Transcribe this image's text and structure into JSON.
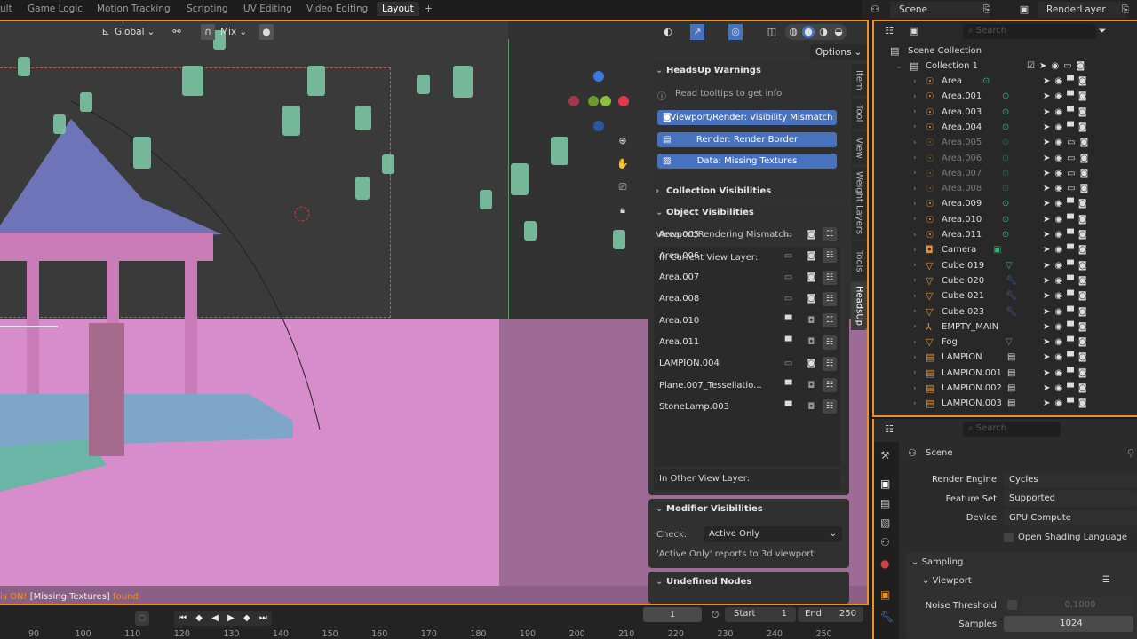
{
  "workspace_tabs": [
    "ult",
    "Game Logic",
    "Motion Tracking",
    "Scripting",
    "UV Editing",
    "Video Editing",
    "Layout"
  ],
  "active_workspace": "Layout",
  "add_workspace": "+",
  "scene_selector": {
    "scene": "Scene",
    "view_layer": "RenderLayer"
  },
  "viewport_header": {
    "orientation": "Global",
    "snap_mode": "Mix",
    "options": "Options"
  },
  "viewport_status": {
    "prefix": "is ON!",
    "tag": "[Missing Textures]",
    "suffix": "found"
  },
  "sidebar_tabs": [
    "Item",
    "Tool",
    "View",
    "Weight Layers",
    "Tools",
    "HeadsUp"
  ],
  "active_sidebar_tab": "HeadsUp",
  "headsup": {
    "warnings_title": "HeadsUp Warnings",
    "info": "Read tooltips to get info",
    "buttons": [
      {
        "label": "Viewport/Render: Visibility Mismatch",
        "icon": "camera-icon"
      },
      {
        "label": "Render: Render Border",
        "icon": "printer-icon"
      },
      {
        "label": "Data: Missing Textures",
        "icon": "image-icon"
      }
    ],
    "collection_visibilities": "Collection Visibilities",
    "object_visibilities": "Object Visibilities",
    "mismatch_label": "Viewport/Rendering Mismatch:",
    "current_layer_label": "In Current View Layer:",
    "objects": [
      {
        "name": "Area.005",
        "viewport": false,
        "render": true
      },
      {
        "name": "Area.006",
        "viewport": false,
        "render": true
      },
      {
        "name": "Area.007",
        "viewport": false,
        "render": true
      },
      {
        "name": "Area.008",
        "viewport": false,
        "render": true
      },
      {
        "name": "Area.010",
        "viewport": true,
        "render": false
      },
      {
        "name": "Area.011",
        "viewport": true,
        "render": false
      },
      {
        "name": "LAMPION.004",
        "viewport": false,
        "render": true
      },
      {
        "name": "Plane.007_Tessellatio...",
        "viewport": true,
        "render": false
      },
      {
        "name": "StoneLamp.003",
        "viewport": true,
        "render": false
      }
    ],
    "other_layer_label": "In Other View Layer:",
    "modifier_title": "Modifier Visibilities",
    "check_label": "Check:",
    "check_value": "Active Only",
    "check_note": "'Active Only' reports to 3d viewport",
    "undefined_nodes": "Undefined Nodes"
  },
  "outliner": {
    "search_placeholder": "Search",
    "scene_collection": "Scene Collection",
    "collection": "Collection 1",
    "items": [
      {
        "name": "Area",
        "icon": "light",
        "dim": false
      },
      {
        "name": "Area.001",
        "icon": "light",
        "dim": false
      },
      {
        "name": "Area.003",
        "icon": "light",
        "dim": false
      },
      {
        "name": "Area.004",
        "icon": "light",
        "dim": false
      },
      {
        "name": "Area.005",
        "icon": "light",
        "dim": true
      },
      {
        "name": "Area.006",
        "icon": "light",
        "dim": true
      },
      {
        "name": "Area.007",
        "icon": "light",
        "dim": true
      },
      {
        "name": "Area.008",
        "icon": "light",
        "dim": true
      },
      {
        "name": "Area.009",
        "icon": "light",
        "dim": false
      },
      {
        "name": "Area.010",
        "icon": "light",
        "dim": false
      },
      {
        "name": "Area.011",
        "icon": "light",
        "dim": false
      },
      {
        "name": "Camera",
        "icon": "camera",
        "dim": false
      },
      {
        "name": "Cube.019",
        "icon": "mesh",
        "dim": false
      },
      {
        "name": "Cube.020",
        "icon": "mesh",
        "dim": false
      },
      {
        "name": "Cube.021",
        "icon": "mesh",
        "dim": false
      },
      {
        "name": "Cube.023",
        "icon": "mesh",
        "dim": false
      },
      {
        "name": "EMPTY_MAIN",
        "icon": "empty",
        "dim": false
      },
      {
        "name": "Fog",
        "icon": "mesh",
        "dim": false
      },
      {
        "name": "LAMPION",
        "icon": "collection-instance",
        "dim": false
      },
      {
        "name": "LAMPION.001",
        "icon": "collection-instance",
        "dim": false
      },
      {
        "name": "LAMPION.002",
        "icon": "collection-instance",
        "dim": false
      },
      {
        "name": "LAMPION.003",
        "icon": "collection-instance",
        "dim": false
      }
    ]
  },
  "properties": {
    "search_placeholder": "Search",
    "context": "Scene",
    "render_engine_label": "Render Engine",
    "render_engine": "Cycles",
    "feature_set_label": "Feature Set",
    "feature_set": "Supported",
    "device_label": "Device",
    "device": "GPU Compute",
    "osl_label": "Open Shading Language",
    "sampling": "Sampling",
    "viewport": "Viewport",
    "noise_threshold_label": "Noise Threshold",
    "noise_threshold": "0.1000",
    "samples_label": "Samples",
    "samples": "1024"
  },
  "timeline": {
    "current_frame": "1",
    "start_label": "Start",
    "start": "1",
    "end_label": "End",
    "end": "250",
    "ticks": [
      "90",
      "100",
      "110",
      "120",
      "130",
      "140",
      "150",
      "160",
      "170",
      "180",
      "190",
      "200",
      "210",
      "220",
      "230",
      "240",
      "250"
    ]
  },
  "colors": {
    "accent": "#f0902a",
    "button_blue": "#4772c0",
    "light_green": "#2fae6f"
  }
}
